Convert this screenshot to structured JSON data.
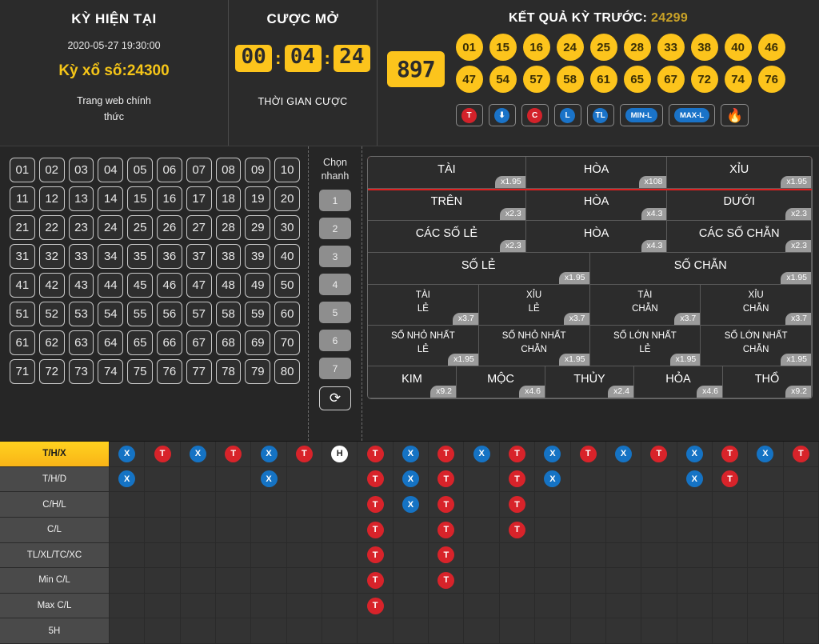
{
  "header": {
    "period": {
      "title": "KỲ HIỆN TẠI",
      "datetime": "2020-05-27 19:30:00",
      "issue": "Kỳ xổ số:24300",
      "sub_line1": "Trang web chính",
      "sub_line2": "thức"
    },
    "bet": {
      "title": "CƯỢC MỞ",
      "hours": "00",
      "minutes": "04",
      "seconds": "24",
      "sep1": ":",
      "sep2": ":",
      "label": "THỜI GIAN CƯỢC"
    },
    "result": {
      "title_prefix": "KẾT QUẢ KỲ TRƯỚC:",
      "issue": "24299",
      "sum": "897",
      "balls_row1": [
        "01",
        "15",
        "16",
        "24",
        "25",
        "28",
        "33",
        "38",
        "40",
        "46"
      ],
      "balls_row2": [
        "47",
        "54",
        "57",
        "58",
        "61",
        "65",
        "67",
        "72",
        "74",
        "76"
      ],
      "tags": [
        {
          "name": "tag-t",
          "text": "T",
          "style": "circ red"
        },
        {
          "name": "tag-down",
          "text": "⬇",
          "style": "circ blue"
        },
        {
          "name": "tag-c",
          "text": "C",
          "style": "circ red"
        },
        {
          "name": "tag-l",
          "text": "L",
          "style": "circ blue"
        },
        {
          "name": "tag-tl",
          "text": "TL",
          "style": "circ blue"
        },
        {
          "name": "tag-min-l",
          "text": "MIN-L",
          "style": "pill blue"
        },
        {
          "name": "tag-max-l",
          "text": "MAX-L",
          "style": "pill blue"
        },
        {
          "name": "tag-fire",
          "text": "🔥",
          "style": "flame"
        }
      ]
    }
  },
  "numbers": {
    "cells": [
      "01",
      "02",
      "03",
      "04",
      "05",
      "06",
      "07",
      "08",
      "09",
      "10",
      "11",
      "12",
      "13",
      "14",
      "15",
      "16",
      "17",
      "18",
      "19",
      "20",
      "21",
      "22",
      "23",
      "24",
      "25",
      "26",
      "27",
      "28",
      "29",
      "30",
      "31",
      "32",
      "33",
      "34",
      "35",
      "36",
      "37",
      "38",
      "39",
      "40",
      "41",
      "42",
      "43",
      "44",
      "45",
      "46",
      "47",
      "48",
      "49",
      "50",
      "51",
      "52",
      "53",
      "54",
      "55",
      "56",
      "57",
      "58",
      "59",
      "60",
      "61",
      "62",
      "63",
      "64",
      "65",
      "66",
      "67",
      "68",
      "69",
      "70",
      "71",
      "72",
      "73",
      "74",
      "75",
      "76",
      "77",
      "78",
      "79",
      "80"
    ]
  },
  "quick_select": {
    "label_line1": "Chọn",
    "label_line2": "nhanh",
    "buttons": [
      "1",
      "2",
      "3",
      "4",
      "5",
      "6",
      "7"
    ],
    "refresh_icon": "⟳"
  },
  "bets": {
    "rows": [
      {
        "highlight": true,
        "size": "lg",
        "cells": [
          {
            "label": "TÀI",
            "mult": "x1.95",
            "flex": 1.46
          },
          {
            "label": "HÒA",
            "mult": "x108",
            "flex": 1.3
          },
          {
            "label": "XỈU",
            "mult": "x1.95",
            "flex": 1.33
          }
        ]
      },
      {
        "highlight": false,
        "size": "md",
        "cells": [
          {
            "label": "TRÊN",
            "mult": "x2.3",
            "flex": 1.46
          },
          {
            "label": "HÒA",
            "mult": "x4.3",
            "flex": 1.3
          },
          {
            "label": "DƯỚI",
            "mult": "x2.3",
            "flex": 1.33
          }
        ]
      },
      {
        "highlight": false,
        "size": "md",
        "cells": [
          {
            "label": "CÁC SỐ LẺ",
            "mult": "x2.3",
            "flex": 1.46
          },
          {
            "label": "HÒA",
            "mult": "x4.3",
            "flex": 1.3
          },
          {
            "label": "CÁC SỐ CHẴN",
            "mult": "x2.3",
            "flex": 1.33
          }
        ]
      },
      {
        "highlight": false,
        "size": "md",
        "cells": [
          {
            "label": "SỐ LẺ",
            "mult": "x1.95",
            "flex": 1
          },
          {
            "label": "SỐ CHẴN",
            "mult": "x1.95",
            "flex": 1
          }
        ]
      },
      {
        "highlight": false,
        "size": "tall",
        "cells": [
          {
            "label": "TÀI",
            "label2": "LẺ",
            "mult": "x3.7",
            "flex": 1
          },
          {
            "label": "XỈU",
            "label2": "LẺ",
            "mult": "x3.7",
            "flex": 1
          },
          {
            "label": "TÀI",
            "label2": "CHẴN",
            "mult": "x3.7",
            "flex": 1
          },
          {
            "label": "XỈU",
            "label2": "CHẴN",
            "mult": "x3.7",
            "flex": 1
          }
        ]
      },
      {
        "highlight": false,
        "size": "tall",
        "cells": [
          {
            "label": "SỐ NHỎ NHẤT",
            "label2": "LẺ",
            "mult": "x1.95",
            "flex": 1
          },
          {
            "label": "SỐ NHỎ NHẤT",
            "label2": "CHẴN",
            "mult": "x1.95",
            "flex": 1
          },
          {
            "label": "SỐ LỚN NHẤT",
            "label2": "LẺ",
            "mult": "x1.95",
            "flex": 1
          },
          {
            "label": "SỐ LỚN NHẤT",
            "label2": "CHẴN",
            "mult": "x1.95",
            "flex": 1
          }
        ]
      },
      {
        "highlight": false,
        "size": "md",
        "cells": [
          {
            "label": "KIM",
            "mult": "x9.2",
            "flex": 1
          },
          {
            "label": "MỘC",
            "mult": "x4.6",
            "flex": 1
          },
          {
            "label": "THỦY",
            "mult": "x2.4",
            "flex": 1
          },
          {
            "label": "HỎA",
            "mult": "x4.6",
            "flex": 1
          },
          {
            "label": "THỔ",
            "mult": "x9.2",
            "flex": 1
          }
        ]
      }
    ]
  },
  "history": {
    "columns": 20,
    "rows": [
      {
        "label": "T/H/X",
        "active": true,
        "marks": [
          "X",
          "T",
          "X",
          "T",
          "X",
          "T",
          "H",
          "T",
          "X",
          "T",
          "X",
          "T",
          "X",
          "T",
          "X",
          "T",
          "X",
          "T",
          "X",
          "T"
        ]
      },
      {
        "label": "T/H/D",
        "active": false,
        "marks": [
          "X",
          "",
          "",
          "",
          "X",
          "",
          "",
          "T",
          "X",
          "T",
          "",
          "T",
          "X",
          "",
          "",
          "",
          "X",
          "T",
          "",
          ""
        ]
      },
      {
        "label": "C/H/L",
        "active": false,
        "marks": [
          "",
          "",
          "",
          "",
          "",
          "",
          "",
          "T",
          "X",
          "T",
          "",
          "T",
          "",
          "",
          "",
          "",
          "",
          "",
          "",
          ""
        ]
      },
      {
        "label": "C/L",
        "active": false,
        "marks": [
          "",
          "",
          "",
          "",
          "",
          "",
          "",
          "T",
          "",
          "T",
          "",
          "T",
          "",
          "",
          "",
          "",
          "",
          "",
          "",
          ""
        ]
      },
      {
        "label": "TL/XL/TC/XC",
        "active": false,
        "marks": [
          "",
          "",
          "",
          "",
          "",
          "",
          "",
          "T",
          "",
          "T",
          "",
          "",
          "",
          "",
          "",
          "",
          "",
          "",
          "",
          ""
        ]
      },
      {
        "label": "Min C/L",
        "active": false,
        "marks": [
          "",
          "",
          "",
          "",
          "",
          "",
          "",
          "T",
          "",
          "T",
          "",
          "",
          "",
          "",
          "",
          "",
          "",
          "",
          "",
          ""
        ]
      },
      {
        "label": "Max C/L",
        "active": false,
        "marks": [
          "",
          "",
          "",
          "",
          "",
          "",
          "",
          "T",
          "",
          "",
          "",
          "",
          "",
          "",
          "",
          "",
          "",
          "",
          "",
          ""
        ]
      },
      {
        "label": "5H",
        "active": false,
        "marks": [
          "",
          "",
          "",
          "",
          "",
          "",
          "",
          "",
          "",
          "",
          "",
          "",
          "",
          "",
          "",
          "",
          "",
          "",
          "",
          ""
        ]
      }
    ]
  },
  "colors": {
    "accent_yellow": "#fcc41c",
    "red_marker": "#d8232a",
    "blue_marker": "#1573c4",
    "highlight_border": "#e02020",
    "background": "#262626"
  }
}
